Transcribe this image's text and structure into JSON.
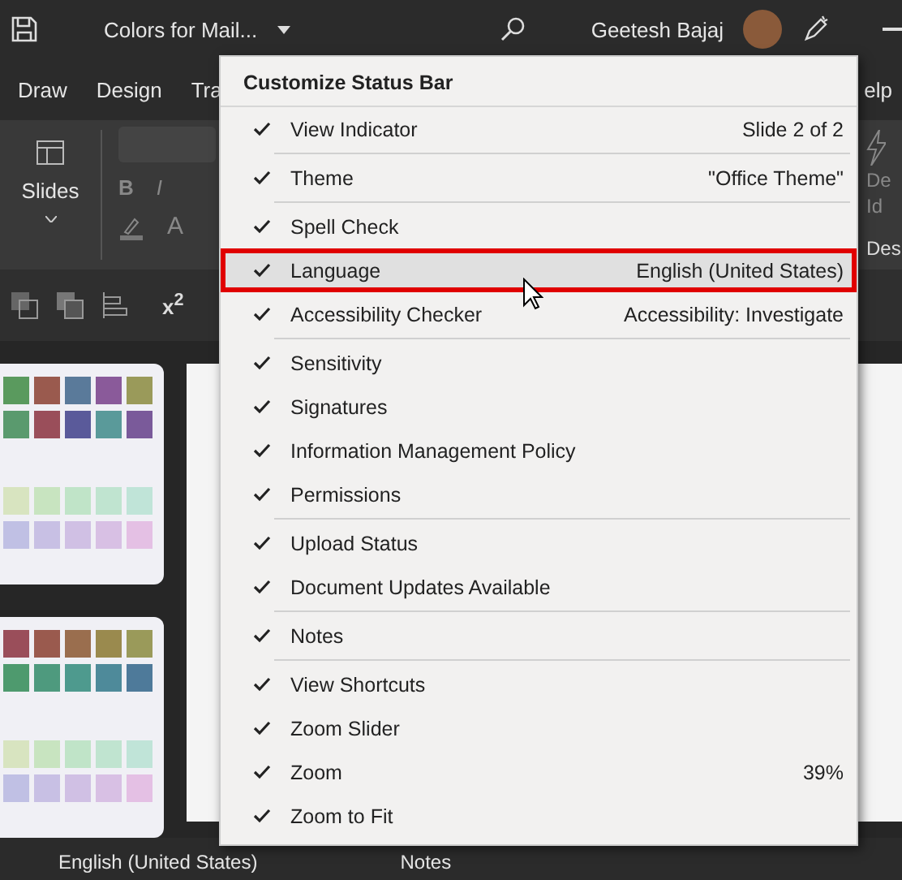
{
  "title_bar": {
    "document_title": "Colors for Mail...",
    "user_name": "Geetesh Bajaj"
  },
  "ribbon_tabs": [
    "Draw",
    "Design",
    "Tra",
    "elp"
  ],
  "ribbon": {
    "slides_label": "Slides",
    "bold": "B",
    "italic": "I",
    "font_color": "A",
    "superscript": "x$^{2}$",
    "designer_partial": [
      "De",
      "Id"
    ],
    "designer_group": "Des"
  },
  "status_bar": {
    "language": "English (United States)",
    "notes": "Notes"
  },
  "menu": {
    "title": "Customize Status Bar",
    "items": [
      {
        "label": "View Indicator",
        "value": "Slide 2 of 2",
        "checked": true,
        "selected": false,
        "divider_after": true
      },
      {
        "label": "Theme",
        "value": "\"Office Theme\"",
        "checked": true,
        "selected": false,
        "divider_after": true
      },
      {
        "label": "Spell Check",
        "checked": true,
        "selected": false,
        "divider_after": false
      },
      {
        "label": "Language",
        "value": "English (United States)",
        "checked": true,
        "selected": true,
        "divider_after": false
      },
      {
        "label": "Accessibility Checker",
        "value": "Accessibility: Investigate",
        "checked": true,
        "selected": false,
        "divider_after": true
      },
      {
        "label": "Sensitivity",
        "checked": true,
        "selected": false,
        "divider_after": false
      },
      {
        "label": "Signatures",
        "checked": true,
        "selected": false,
        "divider_after": false
      },
      {
        "label": "Information Management Policy",
        "checked": true,
        "selected": false,
        "divider_after": false
      },
      {
        "label": "Permissions",
        "checked": true,
        "selected": false,
        "divider_after": true
      },
      {
        "label": "Upload Status",
        "checked": true,
        "selected": false,
        "divider_after": false
      },
      {
        "label": "Document Updates Available",
        "checked": true,
        "selected": false,
        "divider_after": true
      },
      {
        "label": "Notes",
        "checked": true,
        "selected": false,
        "divider_after": true
      },
      {
        "label": "View Shortcuts",
        "checked": true,
        "selected": false,
        "divider_after": false
      },
      {
        "label": "Zoom Slider",
        "checked": true,
        "selected": false,
        "divider_after": false
      },
      {
        "label": "Zoom",
        "value": "39%",
        "checked": true,
        "selected": false,
        "divider_after": false
      },
      {
        "label": "Zoom to Fit",
        "checked": true,
        "selected": false,
        "divider_after": false
      }
    ]
  }
}
